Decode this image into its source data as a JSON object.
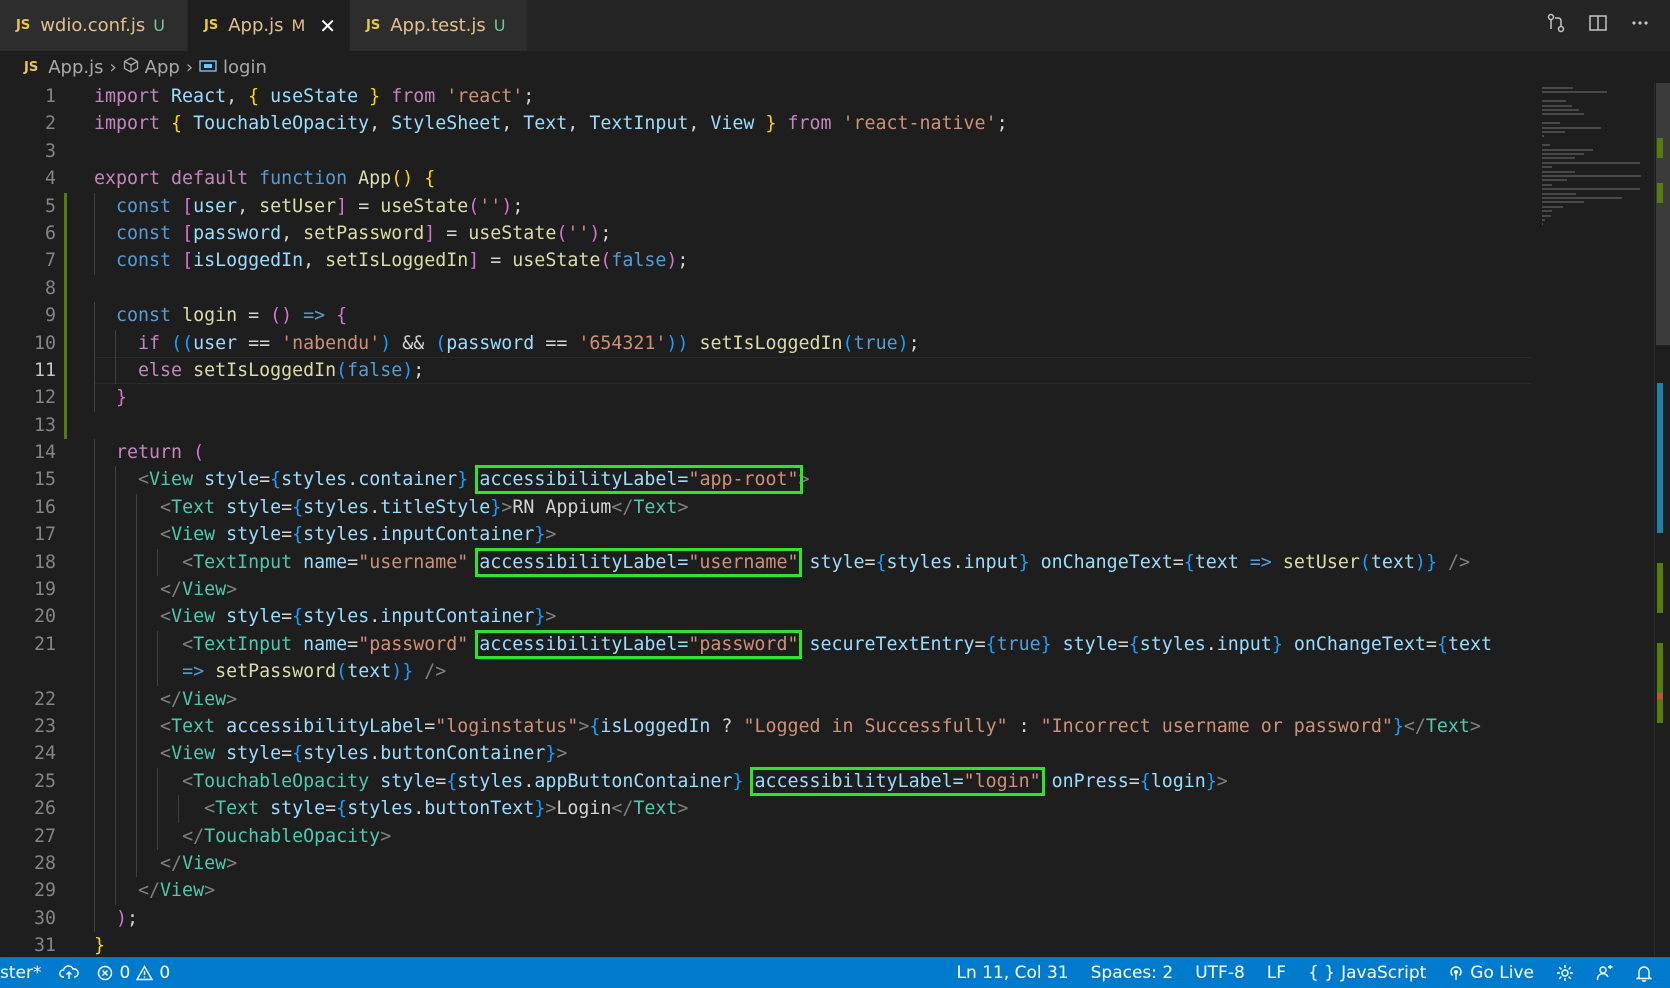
{
  "tabs": [
    {
      "name": "wdio.conf.js",
      "badge": "U",
      "active": false
    },
    {
      "name": "App.js",
      "badge": "M",
      "active": true
    },
    {
      "name": "App.test.js",
      "badge": "U",
      "active": false
    }
  ],
  "tab_icon_label": "JS",
  "tab_close_glyph": "✕",
  "tab_actions": [
    "source-control-icon",
    "split-editor-icon",
    "more-actions-icon"
  ],
  "breadcrumb": {
    "file": "App.js",
    "component": "App",
    "symbol": "login"
  },
  "code": {
    "current_line": 11,
    "line_numbers": [
      "1",
      "2",
      "3",
      "4",
      "5",
      "6",
      "7",
      "8",
      "9",
      "10",
      "11",
      "12",
      "13",
      "14",
      "15",
      "16",
      "17",
      "18",
      "19",
      "20",
      "21",
      "",
      "22",
      "23",
      "24",
      "25",
      "26",
      "27",
      "28",
      "29",
      "30",
      "31"
    ],
    "lines": [
      [
        [
          "kw",
          "import "
        ],
        [
          "var",
          "React"
        ],
        [
          "plain",
          ", "
        ],
        [
          "b1",
          "{ "
        ],
        [
          "var",
          "useState"
        ],
        [
          "b1",
          " }"
        ],
        [
          "kw",
          " from "
        ],
        [
          "str",
          "'react'"
        ],
        [
          "plain",
          ";"
        ]
      ],
      [
        [
          "kw",
          "import "
        ],
        [
          "b1",
          "{ "
        ],
        [
          "var",
          "TouchableOpacity"
        ],
        [
          "plain",
          ", "
        ],
        [
          "var",
          "StyleSheet"
        ],
        [
          "plain",
          ", "
        ],
        [
          "var",
          "Text"
        ],
        [
          "plain",
          ", "
        ],
        [
          "var",
          "TextInput"
        ],
        [
          "plain",
          ", "
        ],
        [
          "var",
          "View"
        ],
        [
          "b1",
          " }"
        ],
        [
          "kw",
          " from "
        ],
        [
          "str",
          "'react-native'"
        ],
        [
          "plain",
          ";"
        ]
      ],
      [],
      [
        [
          "kw",
          "export "
        ],
        [
          "kw",
          "default "
        ],
        [
          "kw2",
          "function "
        ],
        [
          "fn",
          "App"
        ],
        [
          "b1",
          "() {"
        ]
      ],
      [
        [
          "plain",
          "  "
        ],
        [
          "kw2",
          "const "
        ],
        [
          "b2",
          "["
        ],
        [
          "var",
          "user"
        ],
        [
          "plain",
          ", "
        ],
        [
          "fn",
          "setUser"
        ],
        [
          "b2",
          "]"
        ],
        [
          "plain",
          " = "
        ],
        [
          "fn",
          "useState"
        ],
        [
          "b2",
          "("
        ],
        [
          "str",
          "''"
        ],
        [
          "b2",
          ")"
        ],
        [
          "plain",
          ";"
        ]
      ],
      [
        [
          "plain",
          "  "
        ],
        [
          "kw2",
          "const "
        ],
        [
          "b2",
          "["
        ],
        [
          "var",
          "password"
        ],
        [
          "plain",
          ", "
        ],
        [
          "fn",
          "setPassword"
        ],
        [
          "b2",
          "]"
        ],
        [
          "plain",
          " = "
        ],
        [
          "fn",
          "useState"
        ],
        [
          "b2",
          "("
        ],
        [
          "str",
          "''"
        ],
        [
          "b2",
          ")"
        ],
        [
          "plain",
          ";"
        ]
      ],
      [
        [
          "plain",
          "  "
        ],
        [
          "kw2",
          "const "
        ],
        [
          "b2",
          "["
        ],
        [
          "var",
          "isLoggedIn"
        ],
        [
          "plain",
          ", "
        ],
        [
          "fn",
          "setIsLoggedIn"
        ],
        [
          "b2",
          "]"
        ],
        [
          "plain",
          " = "
        ],
        [
          "fn",
          "useState"
        ],
        [
          "b2",
          "("
        ],
        [
          "kw2",
          "false"
        ],
        [
          "b2",
          ")"
        ],
        [
          "plain",
          ";"
        ]
      ],
      [],
      [
        [
          "plain",
          "  "
        ],
        [
          "kw2",
          "const "
        ],
        [
          "fn",
          "login"
        ],
        [
          "plain",
          " = "
        ],
        [
          "b2",
          "()"
        ],
        [
          "kw2",
          " => "
        ],
        [
          "b2",
          "{"
        ]
      ],
      [
        [
          "plain",
          "    "
        ],
        [
          "kw",
          "if "
        ],
        [
          "b3",
          "(("
        ],
        [
          "var",
          "user"
        ],
        [
          "plain",
          " == "
        ],
        [
          "str",
          "'nabendu'"
        ],
        [
          "b3",
          ")"
        ],
        [
          "plain",
          " && "
        ],
        [
          "b3",
          "("
        ],
        [
          "var",
          "password"
        ],
        [
          "plain",
          " == "
        ],
        [
          "str",
          "'654321'"
        ],
        [
          "b3",
          "))"
        ],
        [
          "plain",
          " "
        ],
        [
          "fn",
          "setIsLoggedIn"
        ],
        [
          "b3",
          "("
        ],
        [
          "kw2",
          "true"
        ],
        [
          "b3",
          ")"
        ],
        [
          "plain",
          ";"
        ]
      ],
      [
        [
          "plain",
          "    "
        ],
        [
          "kw",
          "else "
        ],
        [
          "fn",
          "setIsLoggedIn"
        ],
        [
          "b3",
          "("
        ],
        [
          "kw2",
          "false"
        ],
        [
          "b3",
          ")"
        ],
        [
          "plain",
          ";"
        ]
      ],
      [
        [
          "plain",
          "  "
        ],
        [
          "b2",
          "}"
        ]
      ],
      [],
      [
        [
          "plain",
          "  "
        ],
        [
          "kw",
          "return "
        ],
        [
          "b2",
          "("
        ]
      ],
      [
        [
          "plain",
          "    "
        ],
        [
          "pun",
          "<"
        ],
        [
          "tag",
          "View"
        ],
        [
          "att",
          " style"
        ],
        [
          "plain",
          "="
        ],
        [
          "b3",
          "{"
        ],
        [
          "var",
          "styles"
        ],
        [
          "plain",
          "."
        ],
        [
          "var",
          "container"
        ],
        [
          "b3",
          "}"
        ],
        [
          "plain",
          " "
        ],
        [
          "hl",
          "accessibilityLabel=",
          "app-root"
        ],
        [
          "pun",
          ">"
        ]
      ],
      [
        [
          "plain",
          "      "
        ],
        [
          "pun",
          "<"
        ],
        [
          "tag",
          "Text"
        ],
        [
          "att",
          " style"
        ],
        [
          "plain",
          "="
        ],
        [
          "b3",
          "{"
        ],
        [
          "var",
          "styles"
        ],
        [
          "plain",
          "."
        ],
        [
          "var",
          "titleStyle"
        ],
        [
          "b3",
          "}"
        ],
        [
          "pun",
          ">"
        ],
        [
          "plain",
          "RN Appium"
        ],
        [
          "pun",
          "</"
        ],
        [
          "tag",
          "Text"
        ],
        [
          "pun",
          ">"
        ]
      ],
      [
        [
          "plain",
          "      "
        ],
        [
          "pun",
          "<"
        ],
        [
          "tag",
          "View"
        ],
        [
          "att",
          " style"
        ],
        [
          "plain",
          "="
        ],
        [
          "b3",
          "{"
        ],
        [
          "var",
          "styles"
        ],
        [
          "plain",
          "."
        ],
        [
          "var",
          "inputContainer"
        ],
        [
          "b3",
          "}"
        ],
        [
          "pun",
          ">"
        ]
      ],
      [
        [
          "plain",
          "        "
        ],
        [
          "pun",
          "<"
        ],
        [
          "tag",
          "TextInput"
        ],
        [
          "att",
          " name"
        ],
        [
          "plain",
          "="
        ],
        [
          "str",
          "\"username\""
        ],
        [
          "plain",
          " "
        ],
        [
          "hl",
          "accessibilityLabel=",
          "username"
        ],
        [
          "att",
          " style"
        ],
        [
          "plain",
          "="
        ],
        [
          "b3",
          "{"
        ],
        [
          "var",
          "styles"
        ],
        [
          "plain",
          "."
        ],
        [
          "var",
          "input"
        ],
        [
          "b3",
          "}"
        ],
        [
          "att",
          " onChangeText"
        ],
        [
          "plain",
          "="
        ],
        [
          "b3",
          "{"
        ],
        [
          "var",
          "text"
        ],
        [
          "kw2",
          " => "
        ],
        [
          "fn",
          "setUser"
        ],
        [
          "b3",
          "("
        ],
        [
          "var",
          "text"
        ],
        [
          "b3",
          ")"
        ],
        [
          "b3",
          "}"
        ],
        [
          "pun",
          " />"
        ]
      ],
      [
        [
          "plain",
          "      "
        ],
        [
          "pun",
          "</"
        ],
        [
          "tag",
          "View"
        ],
        [
          "pun",
          ">"
        ]
      ],
      [
        [
          "plain",
          "      "
        ],
        [
          "pun",
          "<"
        ],
        [
          "tag",
          "View"
        ],
        [
          "att",
          " style"
        ],
        [
          "plain",
          "="
        ],
        [
          "b3",
          "{"
        ],
        [
          "var",
          "styles"
        ],
        [
          "plain",
          "."
        ],
        [
          "var",
          "inputContainer"
        ],
        [
          "b3",
          "}"
        ],
        [
          "pun",
          ">"
        ]
      ],
      [
        [
          "plain",
          "        "
        ],
        [
          "pun",
          "<"
        ],
        [
          "tag",
          "TextInput"
        ],
        [
          "att",
          " name"
        ],
        [
          "plain",
          "="
        ],
        [
          "str",
          "\"password\""
        ],
        [
          "plain",
          " "
        ],
        [
          "hl",
          "accessibilityLabel=",
          "password"
        ],
        [
          "att",
          " secureTextEntry"
        ],
        [
          "plain",
          "="
        ],
        [
          "b3",
          "{"
        ],
        [
          "kw2",
          "true"
        ],
        [
          "b3",
          "}"
        ],
        [
          "att",
          " style"
        ],
        [
          "plain",
          "="
        ],
        [
          "b3",
          "{"
        ],
        [
          "var",
          "styles"
        ],
        [
          "plain",
          "."
        ],
        [
          "var",
          "input"
        ],
        [
          "b3",
          "}"
        ],
        [
          "att",
          " onChangeText"
        ],
        [
          "plain",
          "="
        ],
        [
          "b3",
          "{"
        ],
        [
          "var",
          "text"
        ]
      ],
      [
        [
          "plain",
          "        "
        ],
        [
          "kw2",
          "=> "
        ],
        [
          "fn",
          "setPassword"
        ],
        [
          "b3",
          "("
        ],
        [
          "var",
          "text"
        ],
        [
          "b3",
          ")"
        ],
        [
          "b3",
          "}"
        ],
        [
          "pun",
          " />"
        ]
      ],
      [
        [
          "plain",
          "      "
        ],
        [
          "pun",
          "</"
        ],
        [
          "tag",
          "View"
        ],
        [
          "pun",
          ">"
        ]
      ],
      [
        [
          "plain",
          "      "
        ],
        [
          "pun",
          "<"
        ],
        [
          "tag",
          "Text"
        ],
        [
          "att",
          " accessibilityLabel"
        ],
        [
          "plain",
          "="
        ],
        [
          "str",
          "\"loginstatus\""
        ],
        [
          "pun",
          ">"
        ],
        [
          "b3",
          "{"
        ],
        [
          "var",
          "isLoggedIn"
        ],
        [
          "plain",
          " ? "
        ],
        [
          "str",
          "\"Logged in Successfully\""
        ],
        [
          "plain",
          " : "
        ],
        [
          "str",
          "\"Incorrect username or password\""
        ],
        [
          "b3",
          "}"
        ],
        [
          "pun",
          "</"
        ],
        [
          "tag",
          "Text"
        ],
        [
          "pun",
          ">"
        ]
      ],
      [
        [
          "plain",
          "      "
        ],
        [
          "pun",
          "<"
        ],
        [
          "tag",
          "View"
        ],
        [
          "att",
          " style"
        ],
        [
          "plain",
          "="
        ],
        [
          "b3",
          "{"
        ],
        [
          "var",
          "styles"
        ],
        [
          "plain",
          "."
        ],
        [
          "var",
          "buttonContainer"
        ],
        [
          "b3",
          "}"
        ],
        [
          "pun",
          ">"
        ]
      ],
      [
        [
          "plain",
          "        "
        ],
        [
          "pun",
          "<"
        ],
        [
          "tag",
          "TouchableOpacity"
        ],
        [
          "att",
          " style"
        ],
        [
          "plain",
          "="
        ],
        [
          "b3",
          "{"
        ],
        [
          "var",
          "styles"
        ],
        [
          "plain",
          "."
        ],
        [
          "var",
          "appButtonContainer"
        ],
        [
          "b3",
          "}"
        ],
        [
          "plain",
          " "
        ],
        [
          "hl",
          "accessibilityLabel=",
          "login"
        ],
        [
          "att",
          " onPress"
        ],
        [
          "plain",
          "="
        ],
        [
          "b3",
          "{"
        ],
        [
          "var",
          "login"
        ],
        [
          "b3",
          "}"
        ],
        [
          "pun",
          ">"
        ]
      ],
      [
        [
          "plain",
          "          "
        ],
        [
          "pun",
          "<"
        ],
        [
          "tag",
          "Text"
        ],
        [
          "att",
          " style"
        ],
        [
          "plain",
          "="
        ],
        [
          "b3",
          "{"
        ],
        [
          "var",
          "styles"
        ],
        [
          "plain",
          "."
        ],
        [
          "var",
          "buttonText"
        ],
        [
          "b3",
          "}"
        ],
        [
          "pun",
          ">"
        ],
        [
          "plain",
          "Login"
        ],
        [
          "pun",
          "</"
        ],
        [
          "tag",
          "Text"
        ],
        [
          "pun",
          ">"
        ]
      ],
      [
        [
          "plain",
          "        "
        ],
        [
          "pun",
          "</"
        ],
        [
          "tag",
          "TouchableOpacity"
        ],
        [
          "pun",
          ">"
        ]
      ],
      [
        [
          "plain",
          "      "
        ],
        [
          "pun",
          "</"
        ],
        [
          "tag",
          "View"
        ],
        [
          "pun",
          ">"
        ]
      ],
      [
        [
          "plain",
          "    "
        ],
        [
          "pun",
          "</"
        ],
        [
          "tag",
          "View"
        ],
        [
          "pun",
          ">"
        ]
      ],
      [
        [
          "plain",
          "  "
        ],
        [
          "b2",
          ")"
        ],
        [
          "plain",
          ";"
        ]
      ],
      [
        [
          "b1",
          "}"
        ]
      ]
    ]
  },
  "statusbar": {
    "branch": "ster*",
    "errors": "0",
    "warnings": "0",
    "position": "Ln 11, Col 31",
    "spaces": "Spaces: 2",
    "encoding": "UTF-8",
    "eol": "LF",
    "language": "JavaScript",
    "language_glyph": "{ }",
    "golive": "Go Live"
  },
  "colors": {
    "accent": "#007acc",
    "highlight_box": "#2ee52e",
    "modified_gutter": "#587c0c"
  }
}
